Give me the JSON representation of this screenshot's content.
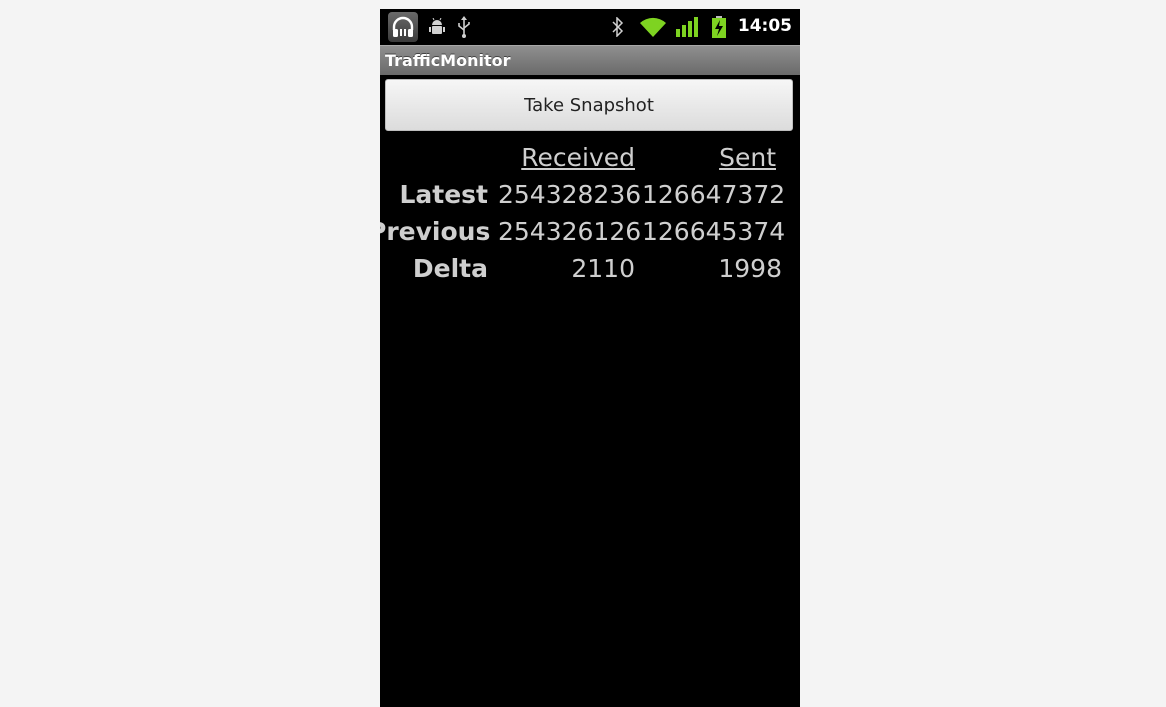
{
  "status_bar": {
    "time": "14:05",
    "icons": [
      "headset-icon",
      "android-debug-icon",
      "usb-icon",
      "bluetooth-icon",
      "wifi-icon",
      "signal-icon",
      "battery-charging-icon"
    ]
  },
  "app": {
    "title": "TrafficMonitor"
  },
  "snapshot_button": {
    "label": "Take Snapshot"
  },
  "table": {
    "headers": {
      "received": "Received",
      "sent": "Sent"
    },
    "rows": [
      {
        "label": "Latest",
        "received": "254328236",
        "sent": "126647372"
      },
      {
        "label": "Previous",
        "received": "254326126",
        "sent": "126645374"
      },
      {
        "label": "Delta",
        "received": "2110",
        "sent": "1998"
      }
    ]
  },
  "colors": {
    "page_background": "#f4f4f4",
    "screen_background": "#000000",
    "titlebar": "#7a7a7a",
    "text": "#cfcfcf",
    "wifi": "#7ed321",
    "signal": "#7ed321"
  }
}
